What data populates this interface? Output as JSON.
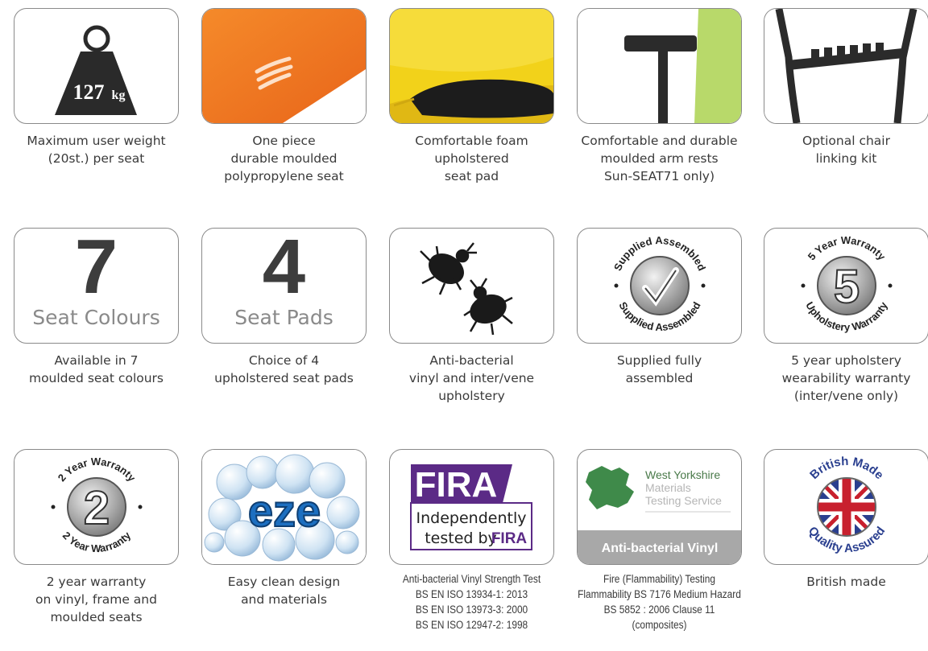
{
  "features": [
    {
      "caption": [
        "Maximum user weight",
        "(20st.) per seat"
      ],
      "weight_value": "127",
      "weight_unit": "kg"
    },
    {
      "caption": [
        "One piece",
        "durable moulded",
        "polypropylene seat"
      ]
    },
    {
      "caption": [
        "Comfortable foam",
        "upholstered",
        "seat pad"
      ]
    },
    {
      "caption": [
        "Comfortable and durable",
        "moulded arm rests",
        "Sun-SEAT71 only)"
      ]
    },
    {
      "caption": [
        "Optional chair",
        "linking kit"
      ]
    },
    {
      "caption": [
        "Available in 7",
        "moulded seat colours"
      ],
      "big": "7",
      "sub": "Seat Colours"
    },
    {
      "caption": [
        "Choice of 4",
        "upholstered seat pads"
      ],
      "big": "4",
      "sub": "Seat Pads"
    },
    {
      "caption": [
        "Anti-bacterial",
        "vinyl and inter/vene",
        "upholstery"
      ]
    },
    {
      "caption": [
        "Supplied fully",
        "assembled"
      ],
      "ring_top": "Supplied Assembled",
      "ring_bottom": "Supplied Assembled"
    },
    {
      "caption": [
        "5 year upholstery",
        "wearability warranty",
        "(inter/vene only)"
      ],
      "big": "5",
      "ring_top": "5 Year Warranty",
      "ring_bottom": "Upholstery Warranty"
    },
    {
      "caption": [
        "2 year warranty",
        "on vinyl, frame and",
        "moulded seats"
      ],
      "big": "2",
      "ring_top": "2 Year Warranty",
      "ring_bottom": "2 Year Warranty"
    },
    {
      "caption": [
        "Easy clean design",
        "and materials"
      ],
      "logo": "eze"
    },
    {
      "caption": [
        "Anti-bacterial Vinyl Strength Test",
        "BS EN ISO 13934-1: 2013",
        "BS EN ISO 13973-3: 2000",
        "BS EN ISO 12947-2: 1998"
      ],
      "logo": "FIRA",
      "line1": "Independently",
      "line2": "tested by",
      "line2b": "FIRA"
    },
    {
      "caption": [
        "Fire (Flammability) Testing",
        "Flammability BS 7176 Medium Hazard",
        "BS 5852 : 2006 Clause 11",
        "(composites)"
      ],
      "org1": "West Yorkshire",
      "org2": "Materials",
      "org3": "Testing Service",
      "band": "Anti-bacterial Vinyl"
    },
    {
      "caption": [
        "British made"
      ],
      "ring_top": "British Made",
      "ring_bottom": "Quality Assured"
    }
  ],
  "colors": {
    "orange": "#f07a1a",
    "yellow": "#f2d21a",
    "green": "#b8d96a",
    "fira_purple": "#5b2a86",
    "charcoal": "#3a3a3a"
  }
}
